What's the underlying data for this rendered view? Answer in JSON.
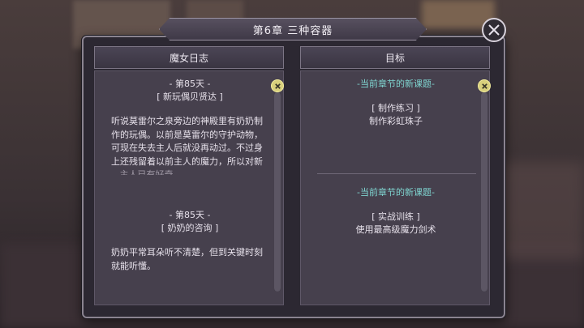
{
  "window": {
    "title": "第6章  三种容器"
  },
  "journal": {
    "header": "魔女日志",
    "entries": [
      {
        "day": "- 第85天 -",
        "title": "[ 新玩偶贝贤达 ]",
        "lines": [
          "听说莫雷尔之泉旁边的神殿里有奶奶制",
          "作的玩偶。以前是莫雷尔的守护动物，",
          "可现在失去主人后就没再动过。不过身",
          "上还残留着以前主人的魔力，所以对新",
          "...主人已有好奇"
        ]
      },
      {
        "day": "- 第85天 -",
        "title": "[ 奶奶的咨询 ]",
        "lines": [
          "奶奶平常耳朵听不清楚，但到关键时刻",
          "就能听懂。"
        ]
      }
    ]
  },
  "goals": {
    "header": "目标",
    "items": [
      {
        "heading": "-当前章节的新课题-",
        "category": "[ 制作练习 ]",
        "task": "制作彩虹珠子"
      },
      {
        "heading": "-当前章节的新课题-",
        "category": "[ 实战训练 ]",
        "task": "使用最高级魔力剑术"
      }
    ]
  },
  "colors": {
    "accent_heading": "#7fd4d0",
    "scroll_marker": "#d8d07c",
    "panel_bg": "#2c2832"
  }
}
